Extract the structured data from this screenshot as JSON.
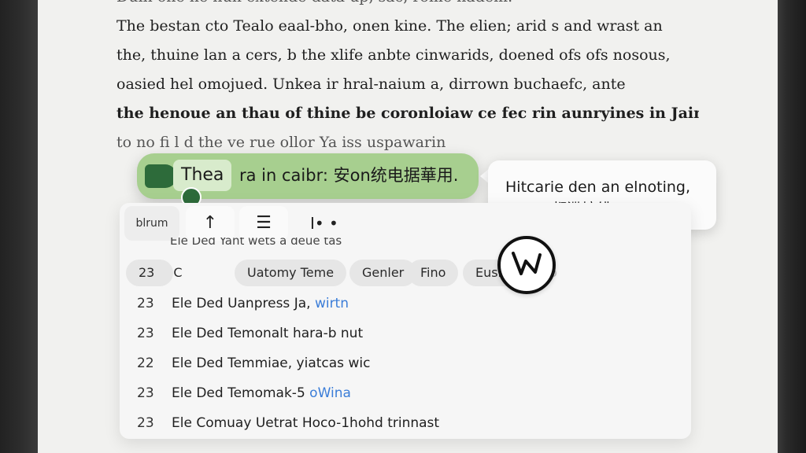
{
  "reader": {
    "lines": [
      "Duin one he nun extende data up, sac, rome hadem.",
      "The bestan cto Tealo eaal-bho, onen kine. The elien; arid s and wrast an",
      "the, thuine lan a cers, b the xlife anbte cinwarids, doened ofs ofs nosous,",
      "oasied hel omojued. Unkea ir hral-naium a, dirrown buchaefc, ante",
      "the henoue an thau of thine be coronloiaw ce fec rin aunryines in Jaines",
      "to no                                    fi  l d    the ve rue ollor Ya iss uspawarin"
    ]
  },
  "selection": {
    "selected_word": "Thea",
    "rest": "ra in caibr: 安on统电据華用."
  },
  "tooltip": {
    "line1": "Hitcarie den an elnoting,",
    "line2": "delam都渫培绯"
  },
  "panel": {
    "toolbar": {
      "label": "blrum",
      "up_icon_glyph": "↑",
      "list_icon_glyph": "☰",
      "more_glyph": "I• •"
    },
    "cut_row": "Ele Ded Yant wets a deue tas",
    "chips": {
      "count": "23",
      "c": "C",
      "topic": "Uatomy Teme",
      "genre": "Genler",
      "find": "Fino",
      "europe": "Eusrow",
      "extra": "o"
    },
    "rows": [
      {
        "num": "23",
        "text": "Ele Ded Uanpress Ja, ",
        "link": "wirtn"
      },
      {
        "num": "23",
        "text": "Ele Ded Temonalt hara-b nut",
        "link": ""
      },
      {
        "num": "22",
        "text": "Ele Ded Temmiae, yiatcas wic",
        "link": ""
      },
      {
        "num": "23",
        "text": "Ele Ded Temomak-5 ",
        "link": "oWina"
      },
      {
        "num": "23",
        "text": "Ele Comuay Uetrat Hoco-1hohd trinnast",
        "link": ""
      }
    ]
  }
}
